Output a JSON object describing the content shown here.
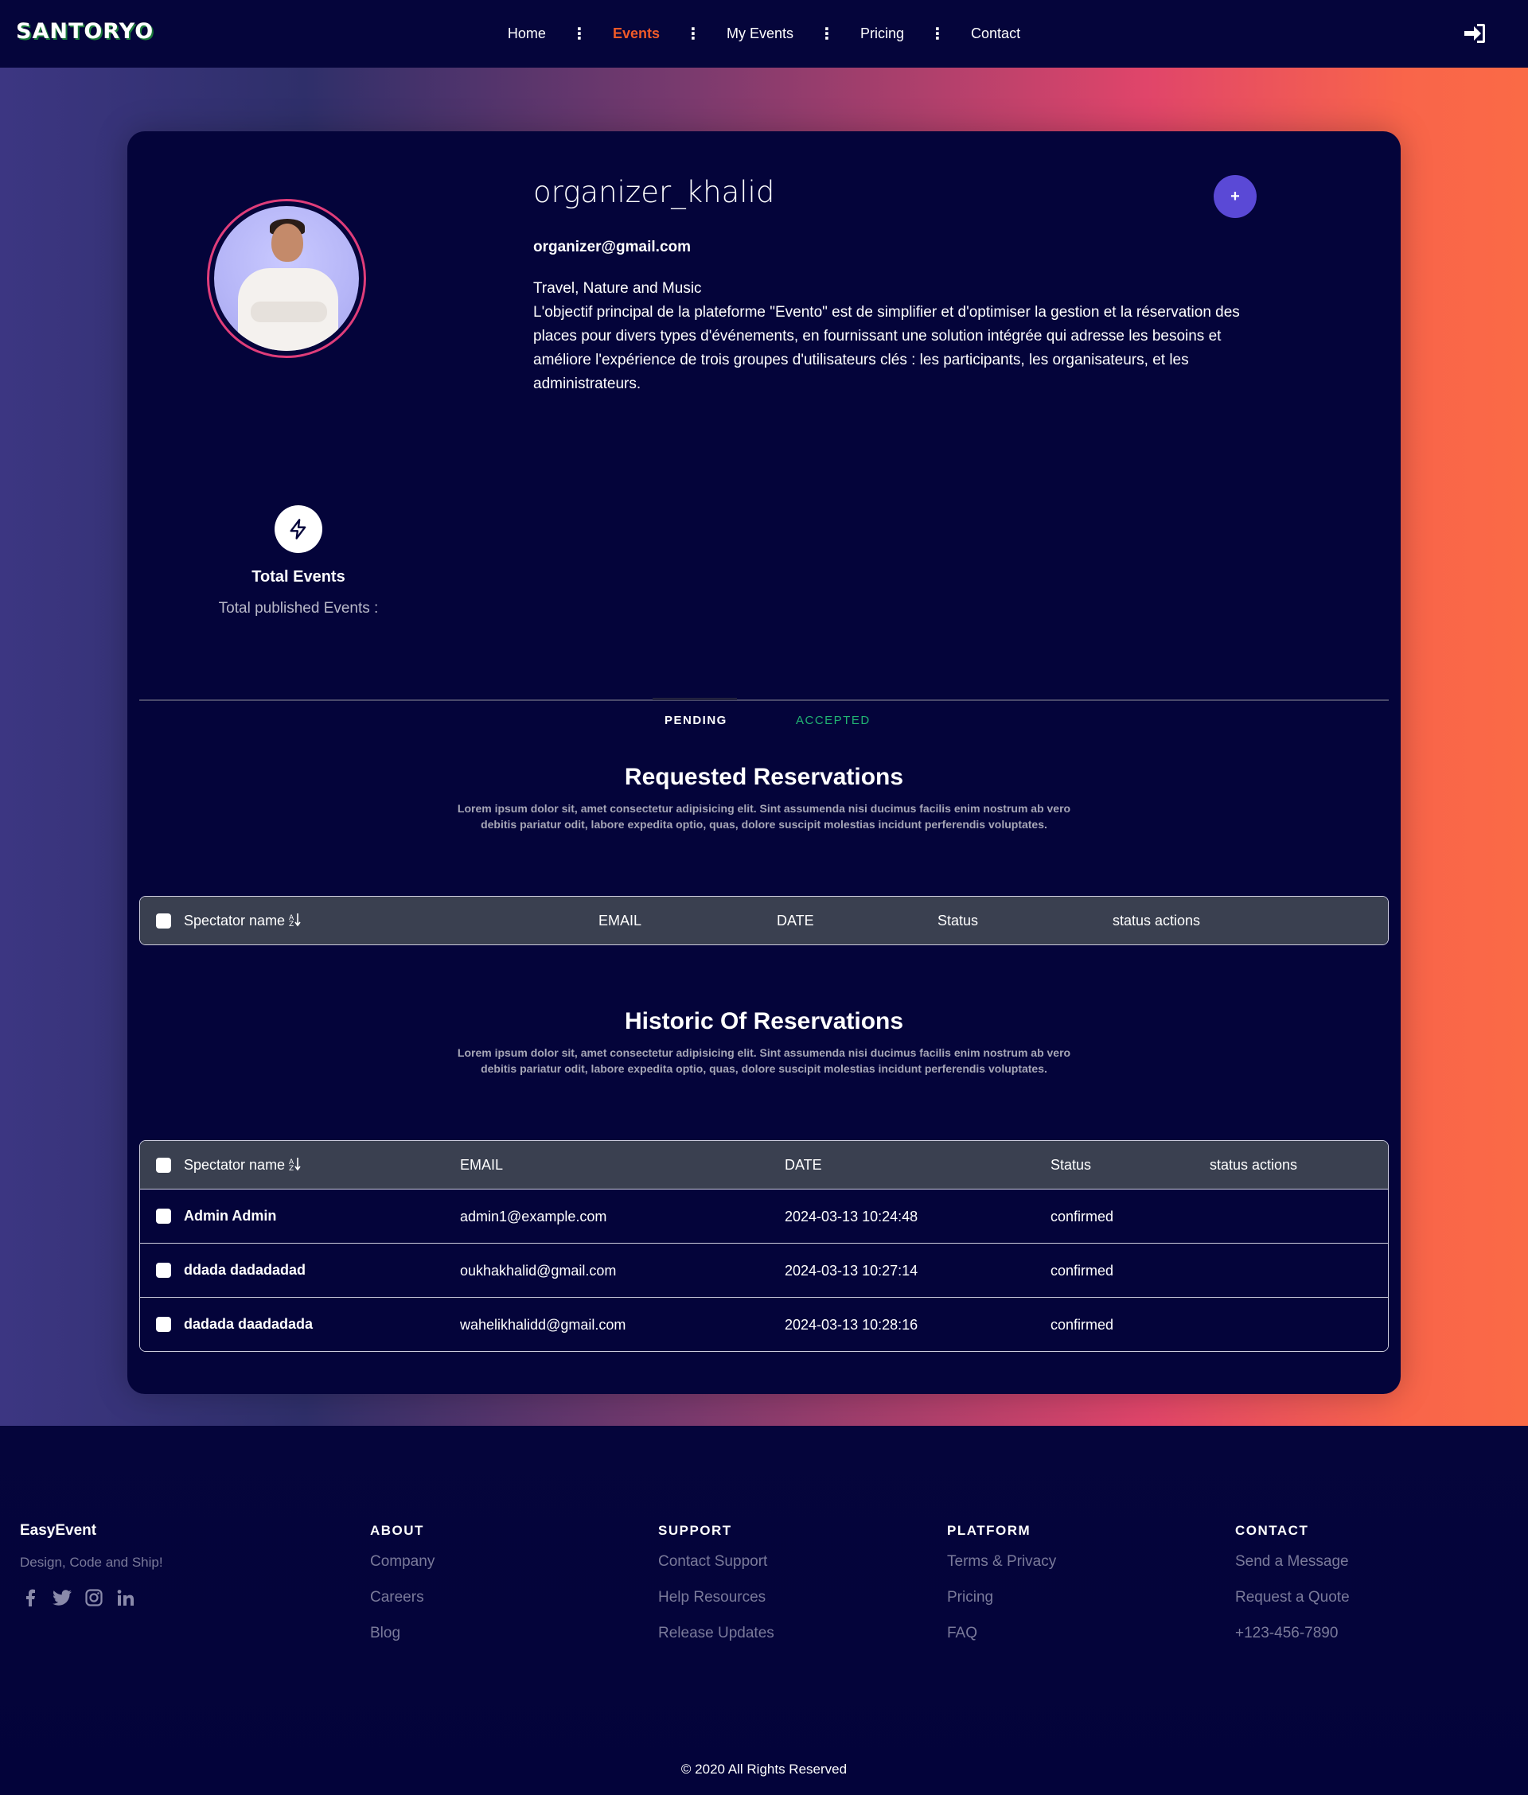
{
  "nav": {
    "logo": "SANTORYO",
    "links": [
      {
        "label": "Home",
        "active": false
      },
      {
        "label": "Events",
        "active": true
      },
      {
        "label": "My Events",
        "active": false
      },
      {
        "label": "Pricing",
        "active": false
      },
      {
        "label": "Contact",
        "active": false
      }
    ],
    "separator": "⋮",
    "login_icon": "sign-in-icon"
  },
  "colors": {
    "accent": "#f05a28",
    "plus_button": "#5a49d6",
    "avatar_ring": "#e03d7a",
    "accepted_tab": "#22b573",
    "background": "#04043a",
    "table_header": "#3a4050"
  },
  "profile": {
    "username": "organizer_khalid",
    "email": "organizer@gmail.com",
    "bio_lines": [
      "Travel, Nature and Music",
      "L'objectif principal de la plateforme \"Evento\" est de simplifier et d'optimiser la gestion et la réservation des places pour divers types d'événements, en fournissant une solution intégrée qui adresse les besoins et améliore l'expérience de trois groupes d'utilisateurs clés : les participants, les organisateurs, et les administrateurs."
    ],
    "add_button": "+"
  },
  "stats": {
    "icon": "lightning-icon",
    "title": "Total Events",
    "subtitle": "Total published Events :"
  },
  "tabs": {
    "pending": "PENDING",
    "accepted": "ACCEPTED"
  },
  "requested": {
    "title": "Requested Reservations",
    "desc": "Lorem ipsum dolor sit, amet consectetur adipisicing elit. Sint assumenda nisi ducimus facilis enim nostrum ab vero debitis pariatur odit, labore expedita optio, quas, dolore suscipit molestias incidunt perferendis voluptates.",
    "columns": [
      "Spectator name",
      "EMAIL",
      "DATE",
      "Status",
      "status actions"
    ],
    "sort_icon": "sort-icon"
  },
  "historic": {
    "title": "Historic Of Reservations",
    "desc": "Lorem ipsum dolor sit, amet consectetur adipisicing elit. Sint assumenda nisi ducimus facilis enim nostrum ab vero debitis pariatur odit, labore expedita optio, quas, dolore suscipit molestias incidunt perferendis voluptates.",
    "columns": [
      "Spectator name",
      "EMAIL",
      "DATE",
      "Status",
      "status actions"
    ],
    "rows": [
      {
        "name": "Admin Admin",
        "email": "admin1@example.com",
        "date": "2024-03-13 10:24:48",
        "status": "confirmed"
      },
      {
        "name": "ddada dadadadad",
        "email": "oukhakhalid@gmail.com",
        "date": "2024-03-13 10:27:14",
        "status": "confirmed"
      },
      {
        "name": "dadada daadadada",
        "email": "wahelikhalidd@gmail.com",
        "date": "2024-03-13 10:28:16",
        "status": "confirmed"
      }
    ]
  },
  "footer": {
    "brand": "EasyEvent",
    "tagline": "Design, Code and Ship!",
    "social": [
      "facebook-icon",
      "twitter-icon",
      "instagram-icon",
      "linkedin-icon"
    ],
    "columns": [
      {
        "title": "ABOUT",
        "items": [
          "Company",
          "Careers",
          "Blog"
        ]
      },
      {
        "title": "SUPPORT",
        "items": [
          "Contact Support",
          "Help Resources",
          "Release Updates"
        ]
      },
      {
        "title": "PLATFORM",
        "items": [
          "Terms & Privacy",
          "Pricing",
          "FAQ"
        ]
      },
      {
        "title": "CONTACT",
        "items": [
          "Send a Message",
          "Request a Quote",
          "+123-456-7890"
        ]
      }
    ],
    "copyright": "© 2020 All Rights Reserved"
  }
}
